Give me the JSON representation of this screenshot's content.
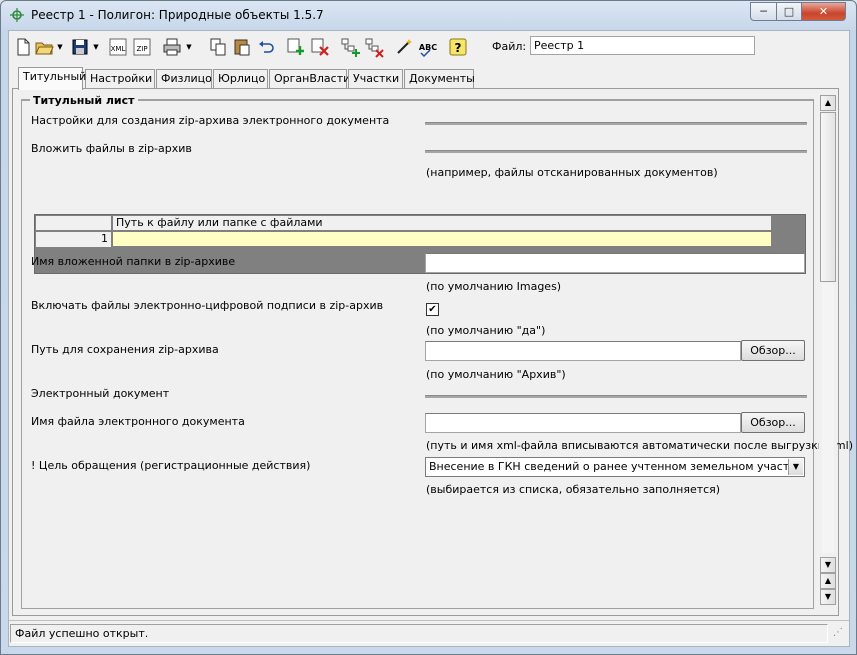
{
  "window": {
    "title": "Реестр 1 - Полигон: Природные объекты 1.5.7",
    "min_label": "─",
    "max_label": "□",
    "close_label": "✕"
  },
  "toolbar": {
    "xml_label": "XML",
    "zip_label": "ZIP",
    "abc_label": "ABC",
    "file_label": "Файл:",
    "file_value": "Реестр 1"
  },
  "tabs": [
    {
      "label": "Титульный"
    },
    {
      "label": "Настройки"
    },
    {
      "label": "Физлицо"
    },
    {
      "label": "Юрлицо"
    },
    {
      "label": "ОрганВласти"
    },
    {
      "label": "Участки"
    },
    {
      "label": "Документы"
    }
  ],
  "form": {
    "group_title": "Титульный лист",
    "zip_settings_label": "Настройки для создания zip-архива электронного документа",
    "attach_files_label": "Вложить файлы в zip-архив",
    "attach_files_hint": "(например, файлы отсканированных документов)",
    "grid": {
      "column_header": "Путь к файлу или папке с файлами",
      "row_number": "1",
      "row_value": ""
    },
    "nested_folder_label": "Имя вложенной папки в zip-архиве",
    "nested_folder_value": "",
    "nested_folder_hint": "(по умолчанию Images)",
    "include_signature_label": "Включать файлы электронно-цифровой подписи в zip-архив",
    "include_signature_checked": "✔",
    "include_signature_hint": "(по умолчанию \"да\")",
    "save_path_label": "Путь для сохранения zip-архива",
    "save_path_value": "",
    "browse_label": "Обзор...",
    "save_path_hint": "(по умолчанию \"Архив\")",
    "edoc_label": "Электронный документ",
    "edoc_filename_label": "Имя файла электронного документа",
    "edoc_filename_value": "",
    "edoc_filename_hint": "(путь и имя xml-файла вписываются автоматически после выгрузки xml)",
    "purpose_label": "! Цель обращения (регистрационные действия)",
    "purpose_value": "Внесение в ГКН сведений о ранее учтенном земельном участке",
    "purpose_hint": "(выбирается из списка, обязательно заполняется)"
  },
  "scrollbar": {
    "up_arrow": "▲",
    "down_arrow": "▼"
  },
  "status": {
    "message": "Файл успешно открыт."
  },
  "colors": {
    "grid_row_highlight": "#ffffc4",
    "close_button": "#c8452c"
  }
}
